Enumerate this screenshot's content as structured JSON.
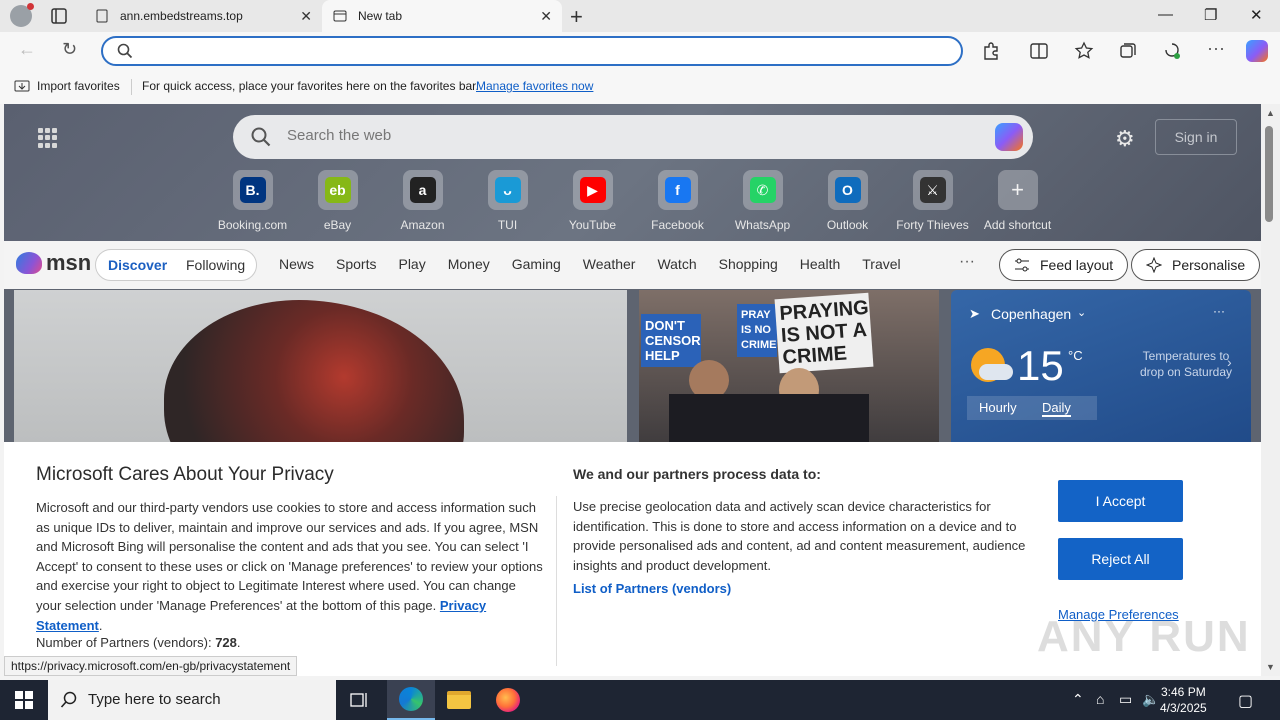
{
  "browser": {
    "tabs": [
      {
        "title": "ann.embedstreams.top"
      },
      {
        "title": "New tab"
      }
    ],
    "address_value": "",
    "favorites_bar": {
      "import_label": "Import favorites",
      "message": "For quick access, place your favorites here on the favorites bar.",
      "link": "Manage favorites now"
    }
  },
  "newtab": {
    "search_placeholder": "Search the web",
    "sign_in": "Sign in",
    "shortcuts": [
      {
        "label": "Booking.com",
        "glyph": "B.",
        "color": "#003580"
      },
      {
        "label": "eBay",
        "glyph": "eb",
        "color": "#86b817"
      },
      {
        "label": "Amazon",
        "glyph": "a",
        "color": "#222222"
      },
      {
        "label": "TUI",
        "glyph": "ᴗ",
        "color": "#1a9ad6"
      },
      {
        "label": "YouTube",
        "glyph": "▶",
        "color": "#ff0000"
      },
      {
        "label": "Facebook",
        "glyph": "f",
        "color": "#1877f2"
      },
      {
        "label": "WhatsApp",
        "glyph": "✆",
        "color": "#25d366"
      },
      {
        "label": "Outlook",
        "glyph": "O",
        "color": "#0f6cbd"
      },
      {
        "label": "Forty Thieves",
        "glyph": "⚔",
        "color": "#333333"
      },
      {
        "label": "Add shortcut",
        "glyph": "+",
        "color": "transparent"
      }
    ]
  },
  "msn": {
    "logo": "msn",
    "discover": "Discover",
    "following": "Following",
    "categories": [
      "News",
      "Sports",
      "Play",
      "Money",
      "Gaming",
      "Weather",
      "Watch",
      "Shopping",
      "Health",
      "Travel"
    ],
    "more": "···",
    "feed_layout": "Feed layout",
    "personalise": "Personalise"
  },
  "cards": {
    "protest_signs": [
      "DON'T CENSOR HELP",
      "PRAY IS NO CRIME",
      "PRAYING IS NOT A CRIME"
    ]
  },
  "weather": {
    "city": "Copenhagen",
    "temperature": "15",
    "unit": "°C",
    "note": "Temperatures to drop on Saturday",
    "tabs": [
      "Hourly",
      "Daily"
    ],
    "more": "···"
  },
  "consent": {
    "title": "Microsoft Cares About Your Privacy",
    "body": "Microsoft and our third-party vendors use cookies to store and access information such as unique IDs to deliver, maintain and improve our services and ads. If you agree, MSN and Microsoft Bing will personalise the content and ads that you see. You can select 'I Accept' to consent to these uses or click on 'Manage preferences' to review your options and exercise your right to object to Legitimate Interest where used.  You can change your selection under 'Manage Preferences' at the bottom of this page.",
    "privacy_link": "Privacy Statement",
    "partners_label": "Number of Partners (vendors):",
    "partners_count": "728",
    "right_title": "We and our partners process data to:",
    "right_body": "Use precise geolocation data and actively scan device characteristics for identification. This is done to store and access information on a device and to provide personalised ads and content, ad and content measurement, audience insights and product development.",
    "partners_link": "List of Partners (vendors)",
    "accept": "I Accept",
    "reject": "Reject All",
    "manage": "Manage Preferences"
  },
  "status_url": "https://privacy.microsoft.com/en-gb/privacystatement",
  "watermark": "ANY RUN",
  "taskbar": {
    "search_placeholder": "Type here to search",
    "time": "3:46 PM",
    "date": "4/3/2025"
  }
}
